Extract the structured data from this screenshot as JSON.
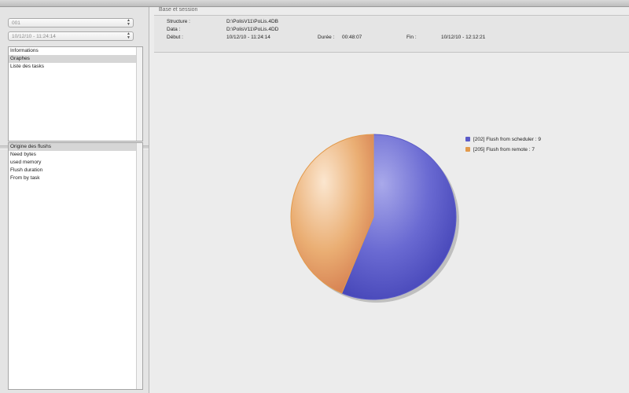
{
  "left": {
    "combo_top": "001",
    "combo_date": "10/12/10 - 11:24:14",
    "list1": [
      {
        "label": "Informations",
        "selected": false
      },
      {
        "label": "Graphes",
        "selected": true
      },
      {
        "label": "Liste des tasks",
        "selected": false
      }
    ],
    "list2": [
      {
        "label": "Origine des flushs",
        "selected": true
      },
      {
        "label": "Need bytes",
        "selected": false
      },
      {
        "label": "used memory",
        "selected": false
      },
      {
        "label": "Flush duration",
        "selected": false
      },
      {
        "label": "From by task",
        "selected": false
      }
    ]
  },
  "session": {
    "title": "Base et session",
    "structure_label": "Structure :",
    "structure_value": "D:\\PolisV11\\PoLis.4DB",
    "data_label": "Data :",
    "data_value": "D:\\PolisV11\\PoLis.4DD",
    "debut_label": "Début :",
    "debut_value": "10/12/10 - 11:24:14",
    "duree_label": "Durée :",
    "duree_value": "00:48:07",
    "fin_label": "Fin :",
    "fin_value": "10/12/10 - 12:12:21"
  },
  "chart_data": {
    "type": "pie",
    "slices": [
      {
        "label": "[202] Flush from scheduler : 9",
        "value": 9,
        "color": "#5b5bc8"
      },
      {
        "label": "[205] Flush from remote : 7",
        "value": 7,
        "color": "#e29a4c"
      }
    ]
  }
}
